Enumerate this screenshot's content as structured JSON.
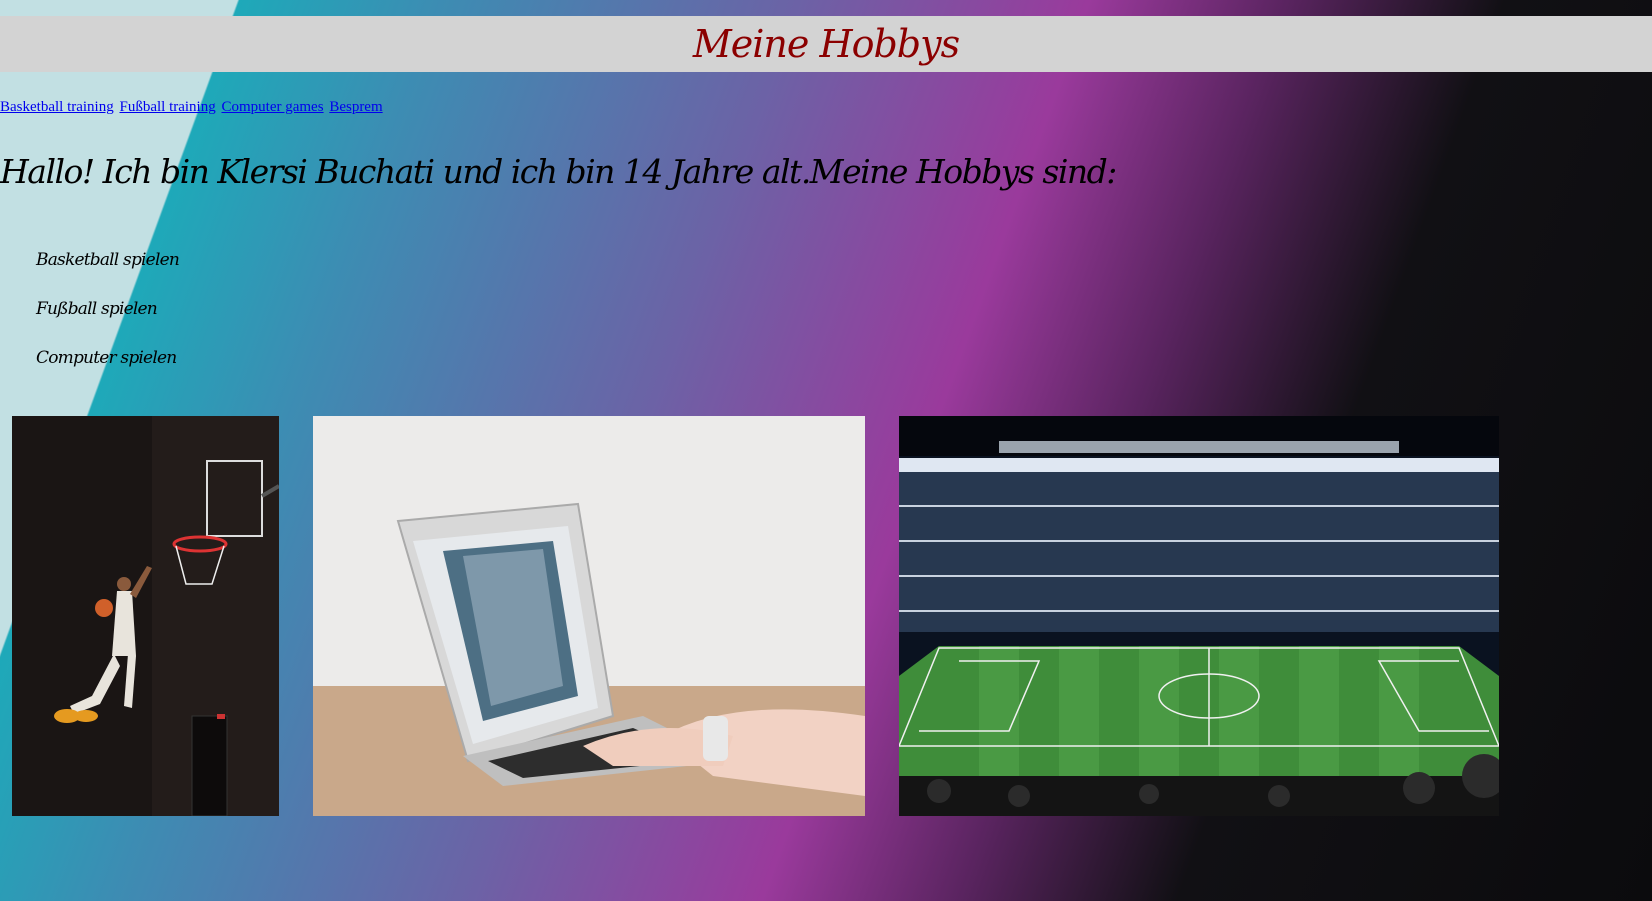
{
  "header": {
    "title": "Meine Hobbys"
  },
  "nav": {
    "links": [
      "Basketball training",
      "Fußball training",
      "Computer games",
      "Besprem"
    ]
  },
  "intro": "Hallo! Ich bin Klersi Buchati und ich bin 14 Jahre alt.Meine Hobbys sind:",
  "hobbies": [
    "Basketball spielen",
    "Fußball spielen",
    "Computer spielen"
  ],
  "images": [
    {
      "name": "basketball-photo",
      "subject": "basketball player dunking"
    },
    {
      "name": "laptop-photo",
      "subject": "hands typing on a laptop"
    },
    {
      "name": "stadium-photo",
      "subject": "football stadium with crowd"
    }
  ],
  "colors": {
    "title": "#8b0000",
    "header_bg": "#d3d3d3",
    "link": "#0000ee"
  }
}
